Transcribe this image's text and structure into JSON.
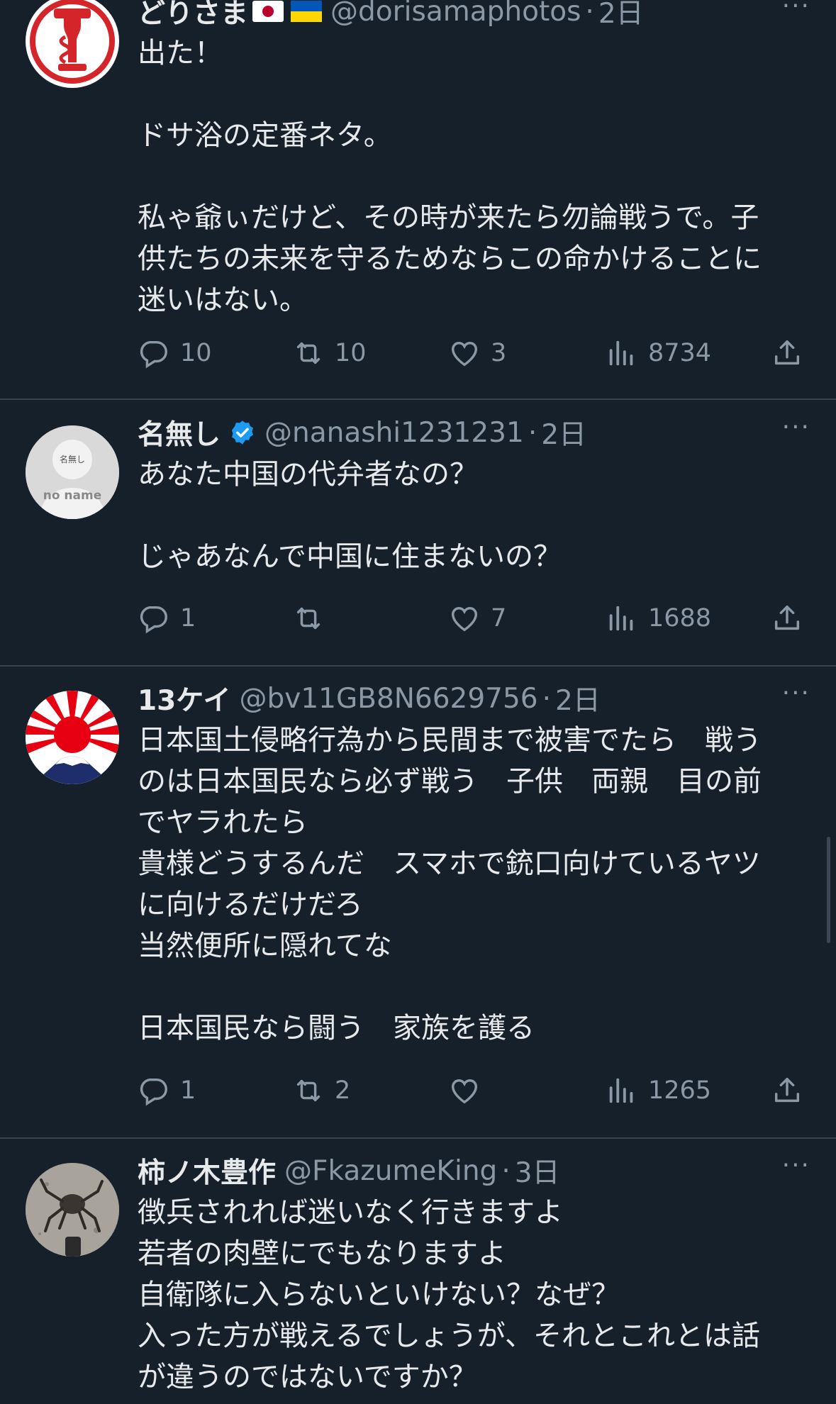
{
  "colors": {
    "background": "#15202b",
    "text": "#e7e9ea",
    "secondary": "#8b98a5",
    "divider": "#38444d",
    "verified": "#1d9bf0"
  },
  "tweets": [
    {
      "name": "どりさま",
      "flags": [
        "japan-flag-icon",
        "ukraine-flag-icon"
      ],
      "handle": "@dorisamaphotos",
      "sep": "·",
      "time": "2日",
      "more": "···",
      "lines": [
        "出た！",
        "",
        "ドサ浴の定番ネタ。",
        "",
        "私ゃ爺ぃだけど、その時が来たら勿論戦うで。子",
        "供たちの未来を守るためならこの命かけることに",
        "迷いはない。"
      ],
      "replies": "10",
      "retweets": "10",
      "likes": "3",
      "views": "8734"
    },
    {
      "name": "名無し",
      "verified": true,
      "handle": "@nanashi1231231",
      "sep": "·",
      "time": "2日",
      "more": "···",
      "avatar_text_top": "名無し",
      "avatar_text_bottom": "no name",
      "lines": [
        "あなた中国の代弁者なの？",
        "",
        "じゃあなんで中国に住まないの？"
      ],
      "replies": "1",
      "retweets": "",
      "likes": "7",
      "views": "1688"
    },
    {
      "name": "13ケイ",
      "handle": "@bv11GB8N6629756",
      "sep": "·",
      "time": "2日",
      "more": "···",
      "lines": [
        "日本国土侵略行為から民間まで被害でたら　戦う",
        "のは日本国民なら必ず戦う　子供　両親　目の前",
        "でヤラれたら",
        "貴様どうするんだ　スマホで銃口向けているヤツ",
        "に向けるだけだろ",
        "当然便所に隠れてな",
        "",
        "日本国民なら闘う　家族を護る"
      ],
      "replies": "1",
      "retweets": "2",
      "likes": "",
      "views": "1265"
    },
    {
      "name": "柿ノ木豊作",
      "handle": "@FkazumeKing",
      "sep": "·",
      "time": "3日",
      "more": "···",
      "lines": [
        "徴兵されれば迷いなく行きますよ",
        "若者の肉壁にでもなりますよ",
        "自衛隊に入らないといけない？なぜ？",
        "入った方が戦えるでしょうが、それとこれとは話",
        "が違うのではないですか？"
      ]
    }
  ]
}
